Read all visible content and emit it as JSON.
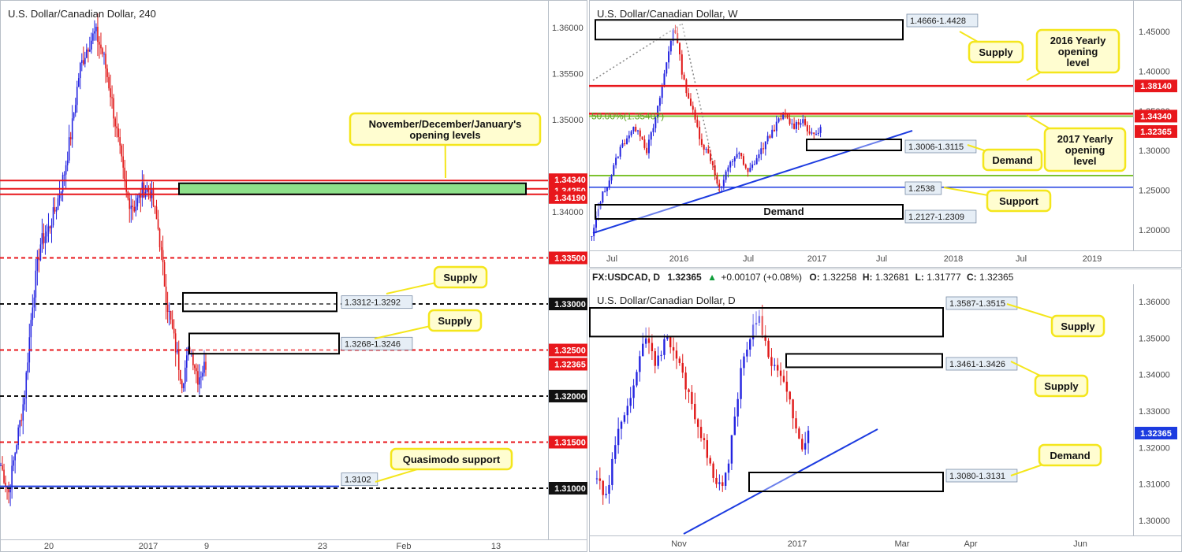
{
  "colors": {
    "up": "#2424e0",
    "down": "#e01818",
    "red_level": "#e8171c",
    "green_level": "#7cc22e",
    "blue_level": "#1c3be0",
    "callout_fill": "#fffdd0",
    "callout_border": "#f4e61c",
    "zone_fill": "#ffffff",
    "green_zone": "#8ee08a",
    "axis_text": "#4a4a4a",
    "tag_fill": "#e6eef6"
  },
  "chart_data": [
    {
      "id": "h4",
      "type": "candlestick",
      "title": "U.S. Dollar/Canadian Dollar, 240",
      "y_ticks": [
        "1.36000",
        "1.35500",
        "1.35000",
        "1.34000",
        "1.33000",
        "1.32000",
        "1.31000"
      ],
      "x_ticks": [
        "20",
        "2017",
        "9",
        "23",
        "Feb",
        "13"
      ],
      "ylim": [
        1.3055,
        1.3655
      ],
      "levels": [
        {
          "value": 1.3434,
          "label": "1.34340",
          "style": "red-solid"
        },
        {
          "value": 1.3425,
          "label": "1.34250",
          "style": "red-solid"
        },
        {
          "value": 1.3419,
          "label": "1.34190",
          "style": "red-solid"
        },
        {
          "value": 1.335,
          "label": "1.33500",
          "style": "red-dash"
        },
        {
          "value": 1.33,
          "label": "1.33000",
          "style": "black-dash"
        },
        {
          "value": 1.325,
          "label": "1.32500",
          "style": "red-dash"
        },
        {
          "value": 1.32,
          "label": "1.32000",
          "style": "black-dash"
        },
        {
          "value": 1.315,
          "label": "1.31500",
          "style": "red-dash"
        },
        {
          "value": 1.31,
          "label": "1.31000",
          "style": "black-dash"
        },
        {
          "value": 1.3102,
          "label": "",
          "style": "blue-solid"
        }
      ],
      "price_tag": "1.32365",
      "zones": [
        {
          "label": "1.3312-1.3292",
          "high": 1.3312,
          "low": 1.3292
        },
        {
          "label": "1.3268-1.3246",
          "high": 1.3268,
          "low": 1.3246
        },
        {
          "label": "1.3102",
          "high": 1.3102,
          "low": 1.3102
        }
      ],
      "callouts": [
        "November/December/January's opening levels",
        "Supply",
        "Supply",
        "Quasimodo support"
      ],
      "anchors": [
        1.3125,
        1.3095,
        1.315,
        1.32,
        1.33,
        1.3365,
        1.338,
        1.3405,
        1.344,
        1.349,
        1.3555,
        1.358,
        1.3595,
        1.357,
        1.3525,
        1.347,
        1.3415,
        1.3405,
        1.3425,
        1.3422,
        1.338,
        1.3305,
        1.326,
        1.3215,
        1.3255,
        1.322,
        1.3235
      ]
    },
    {
      "id": "weekly",
      "type": "candlestick",
      "title": "U.S. Dollar/Canadian Dollar, W",
      "y_ticks": [
        "1.45000",
        "1.40000",
        "1.35000",
        "1.30000",
        "1.25000",
        "1.20000"
      ],
      "x_ticks": [
        "Jul",
        "2016",
        "Jul",
        "2017",
        "Jul",
        "2018",
        "Jul",
        "2019"
      ],
      "ylim": [
        1.17,
        1.475
      ],
      "levels": [
        {
          "value": 1.3814,
          "label": "1.38140",
          "style": "red-solid"
        },
        {
          "value": 1.3434,
          "label": "1.34340",
          "style": "green-solid"
        },
        {
          "value": 1.32365,
          "label": "1.32365",
          "style": "red-solid"
        },
        {
          "value": 1.2685,
          "label": "",
          "style": "green-solid"
        },
        {
          "value": 1.2538,
          "label": "",
          "style": "blue-solid"
        }
      ],
      "fib_label": "50.00%(1.35407)",
      "zones": [
        {
          "label": "1.4666-1.4428",
          "high": 1.4666,
          "low": 1.4428
        },
        {
          "label": "1.3006-1.3115",
          "high": 1.3115,
          "low": 1.3006
        },
        {
          "label": "1.2538",
          "high": 1.2538,
          "low": 1.2538
        },
        {
          "label": "1.2127-1.2309",
          "high": 1.2309,
          "low": 1.2127
        }
      ],
      "zone_center_label": "Demand",
      "callouts": [
        "Supply",
        "2016 Yearly opening level",
        "2017 Yearly opening level",
        "Demand",
        "Support"
      ],
      "anchors": [
        1.19,
        1.24,
        1.265,
        1.3,
        1.32,
        1.33,
        1.3,
        1.34,
        1.4,
        1.46,
        1.39,
        1.35,
        1.31,
        1.29,
        1.25,
        1.28,
        1.3,
        1.27,
        1.29,
        1.31,
        1.33,
        1.345,
        1.33,
        1.34,
        1.318,
        1.326
      ]
    },
    {
      "id": "daily",
      "type": "candlestick",
      "title": "U.S. Dollar/Canadian Dollar, D",
      "header": {
        "symbol": "FX:USDCAD, D",
        "last": "1.32365",
        "change": "+0.00107 (+0.08%)",
        "o_label": "O:",
        "o": "1.32258",
        "h_label": "H:",
        "h": "1.32681",
        "l_label": "L:",
        "l": "1.31777",
        "c_label": "C:",
        "c": "1.32365"
      },
      "y_ticks": [
        "1.36000",
        "1.35000",
        "1.34000",
        "1.33000",
        "1.32000",
        "1.31000",
        "1.30000"
      ],
      "x_ticks": [
        "Nov",
        "2017",
        "Mar",
        "Apr",
        "Jun"
      ],
      "ylim": [
        1.2925,
        1.3625
      ],
      "price_tag": "1.32365",
      "zones": [
        {
          "label": "1.3587-1.3515",
          "high": 1.3587,
          "low": 1.3515
        },
        {
          "label": "1.3461-1.3426",
          "high": 1.3461,
          "low": 1.3426
        },
        {
          "label": "1.3080-1.3131",
          "high": 1.3131,
          "low": 1.308
        }
      ],
      "callouts": [
        "Supply",
        "Supply",
        "Demand"
      ],
      "anchors": [
        1.312,
        1.3045,
        1.318,
        1.329,
        1.335,
        1.343,
        1.352,
        1.342,
        1.35,
        1.347,
        1.341,
        1.334,
        1.326,
        1.318,
        1.312,
        1.308,
        1.324,
        1.34,
        1.35,
        1.357,
        1.348,
        1.342,
        1.339,
        1.33,
        1.32,
        1.3236
      ]
    }
  ]
}
